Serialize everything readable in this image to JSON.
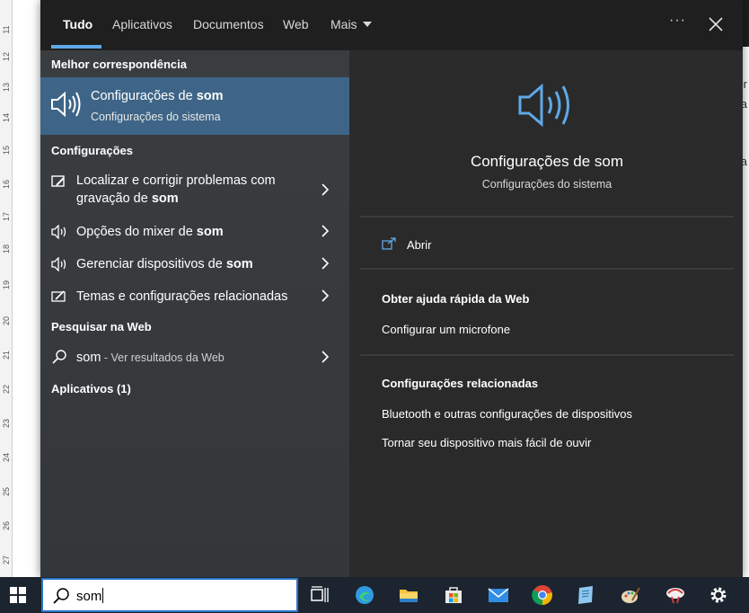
{
  "ruler": {
    "numbers": [
      "11",
      "12",
      "13",
      "14",
      "15",
      "16",
      "17",
      "18",
      "19",
      "20",
      "21",
      "22",
      "23",
      "24",
      "25",
      "26",
      "27"
    ]
  },
  "background": {
    "letters": [
      "Ir",
      "la",
      "a"
    ]
  },
  "tabs": [
    {
      "label": "Tudo"
    },
    {
      "label": "Aplicativos"
    },
    {
      "label": "Documentos"
    },
    {
      "label": "Web"
    },
    {
      "label": "Mais"
    }
  ],
  "toolbar": {
    "ellipsis": "···"
  },
  "left": {
    "best_match_heading": "Melhor correspondência",
    "best_match": {
      "title_prefix": "Configurações de ",
      "title_bold": "som",
      "subtitle": "Configurações do sistema"
    },
    "settings_heading": "Configurações",
    "settings_items": [
      {
        "line1": "Localizar e corrigir problemas com",
        "line2_prefix": "gravação de ",
        "line2_bold": "som"
      },
      {
        "prefix": "Opções do mixer de ",
        "bold": "som"
      },
      {
        "prefix": "Gerenciar dispositivos de ",
        "bold": "som"
      },
      {
        "prefix": "Temas e configurações relacionadas",
        "bold": ""
      }
    ],
    "web_heading": "Pesquisar na Web",
    "web_item": {
      "query": "som",
      "suffix": " - Ver resultados da Web"
    },
    "apps_heading": "Aplicativos (1)"
  },
  "right": {
    "title": "Configurações de som",
    "subtitle": "Configurações do sistema",
    "open_label": "Abrir",
    "web_help_heading": "Obter ajuda rápida da Web",
    "web_help_items": [
      "Configurar um microfone"
    ],
    "related_heading": "Configurações relacionadas",
    "related_items": [
      "Bluetooth e outras configurações de dispositivos",
      "Tornar seu dispositivo mais fácil de ouvir"
    ]
  },
  "taskbar": {
    "search_value": "som",
    "icons": [
      "task-view-icon",
      "edge-icon",
      "file-explorer-icon",
      "microsoft-store-icon",
      "mail-icon",
      "chrome-icon",
      "notepad-icon",
      "paint-icon",
      "snipping-tool-icon",
      "settings-icon"
    ]
  },
  "colors": {
    "accent": "#5fa8e8",
    "highlight": "#3e6587",
    "taskbar_border": "#2a74c8"
  }
}
